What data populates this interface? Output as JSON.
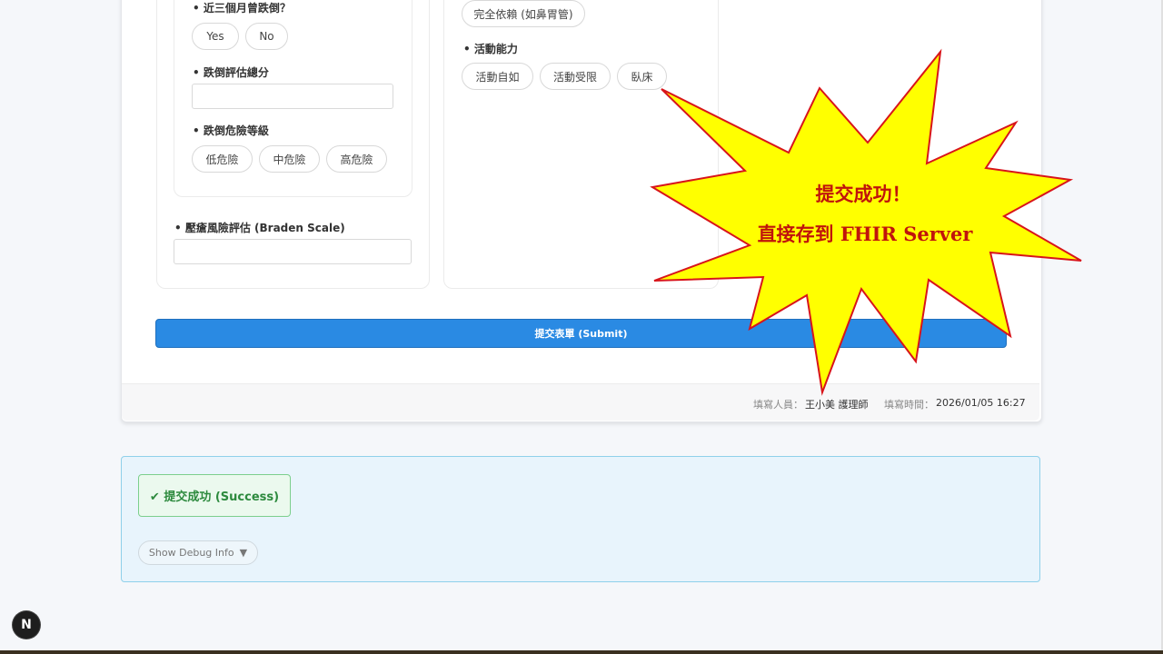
{
  "form": {
    "left": {
      "fall_question": "近三個月曾跌倒？",
      "fall_options": [
        "Yes",
        "No"
      ],
      "fall_score_label": "跌倒評估總分",
      "fall_score_value": "",
      "fall_risk_label": "跌倒危險等級",
      "fall_risk_options": [
        "低危險",
        "中危險",
        "高危險"
      ],
      "braden_label": "壓瘡風險評估 (Braden Scale)",
      "braden_value": ""
    },
    "right": {
      "feeding_option_visible": "完全依賴 (如鼻胃管)",
      "mobility_label": "活動能力",
      "mobility_options": [
        "活動自如",
        "活動受限",
        "臥床"
      ]
    },
    "submit_label": "提交表單 (Submit)",
    "footer": {
      "filler_label": "填寫人員：",
      "filler_value": "王小美 護理師",
      "time_label": "填寫時間：",
      "time_value": "2026/01/05 16:27"
    }
  },
  "result": {
    "success_text": "✔ 提交成功 (Success)",
    "debug_label": "Show Debug Info",
    "debug_arrow": "▼"
  },
  "callout": {
    "line1": "提交成功！",
    "line2": "直接存到 FHIR Server",
    "fill_color": "#ffff00",
    "stroke_color": "#d8141a",
    "text_color": "#c0140c"
  },
  "dev_badge": {
    "letter": "N"
  },
  "icons": {
    "check": "check-icon",
    "chevron": "chevron-down-icon"
  }
}
